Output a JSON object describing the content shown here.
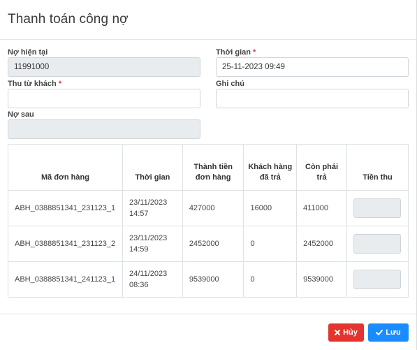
{
  "modal": {
    "title": "Thanh toán công nợ"
  },
  "form": {
    "current_debt": {
      "label": "Nợ hiện tại",
      "value": "11991000"
    },
    "time": {
      "label": "Thời gian",
      "required_mark": "*",
      "value": "25-11-2023 09:49"
    },
    "collect_from_customer": {
      "label": "Thu từ khách",
      "required_mark": "*",
      "value": ""
    },
    "note": {
      "label": "Ghi chú",
      "value": ""
    },
    "debt_after": {
      "label": "Nợ sau",
      "value": ""
    }
  },
  "table": {
    "headers": {
      "order_code": "Mã đơn hàng",
      "time": "Thời gian",
      "order_amount": "Thành tiền đơn hàng",
      "customer_paid": "Khách hàng đã trả",
      "remaining": "Còn phải trả",
      "collect": "Tiền thu"
    },
    "rows": [
      {
        "order_code": "ABH_0388851341_231123_1",
        "time": "23/11/2023 14:57",
        "order_amount": "427000",
        "customer_paid": "16000",
        "remaining": "411000"
      },
      {
        "order_code": "ABH_0388851341_231123_2",
        "time": "23/11/2023 14:59",
        "order_amount": "2452000",
        "customer_paid": "0",
        "remaining": "2452000"
      },
      {
        "order_code": "ABH_0388851341_241123_1",
        "time": "24/11/2023 08:36",
        "order_amount": "9539000",
        "customer_paid": "0",
        "remaining": "9539000"
      }
    ]
  },
  "footer": {
    "cancel_label": "Hủy",
    "save_label": "Lưu",
    "cancel_icon": "close-icon",
    "save_icon": "check-icon",
    "cancel_color": "#e3342f",
    "save_color": "#1a8cff"
  }
}
